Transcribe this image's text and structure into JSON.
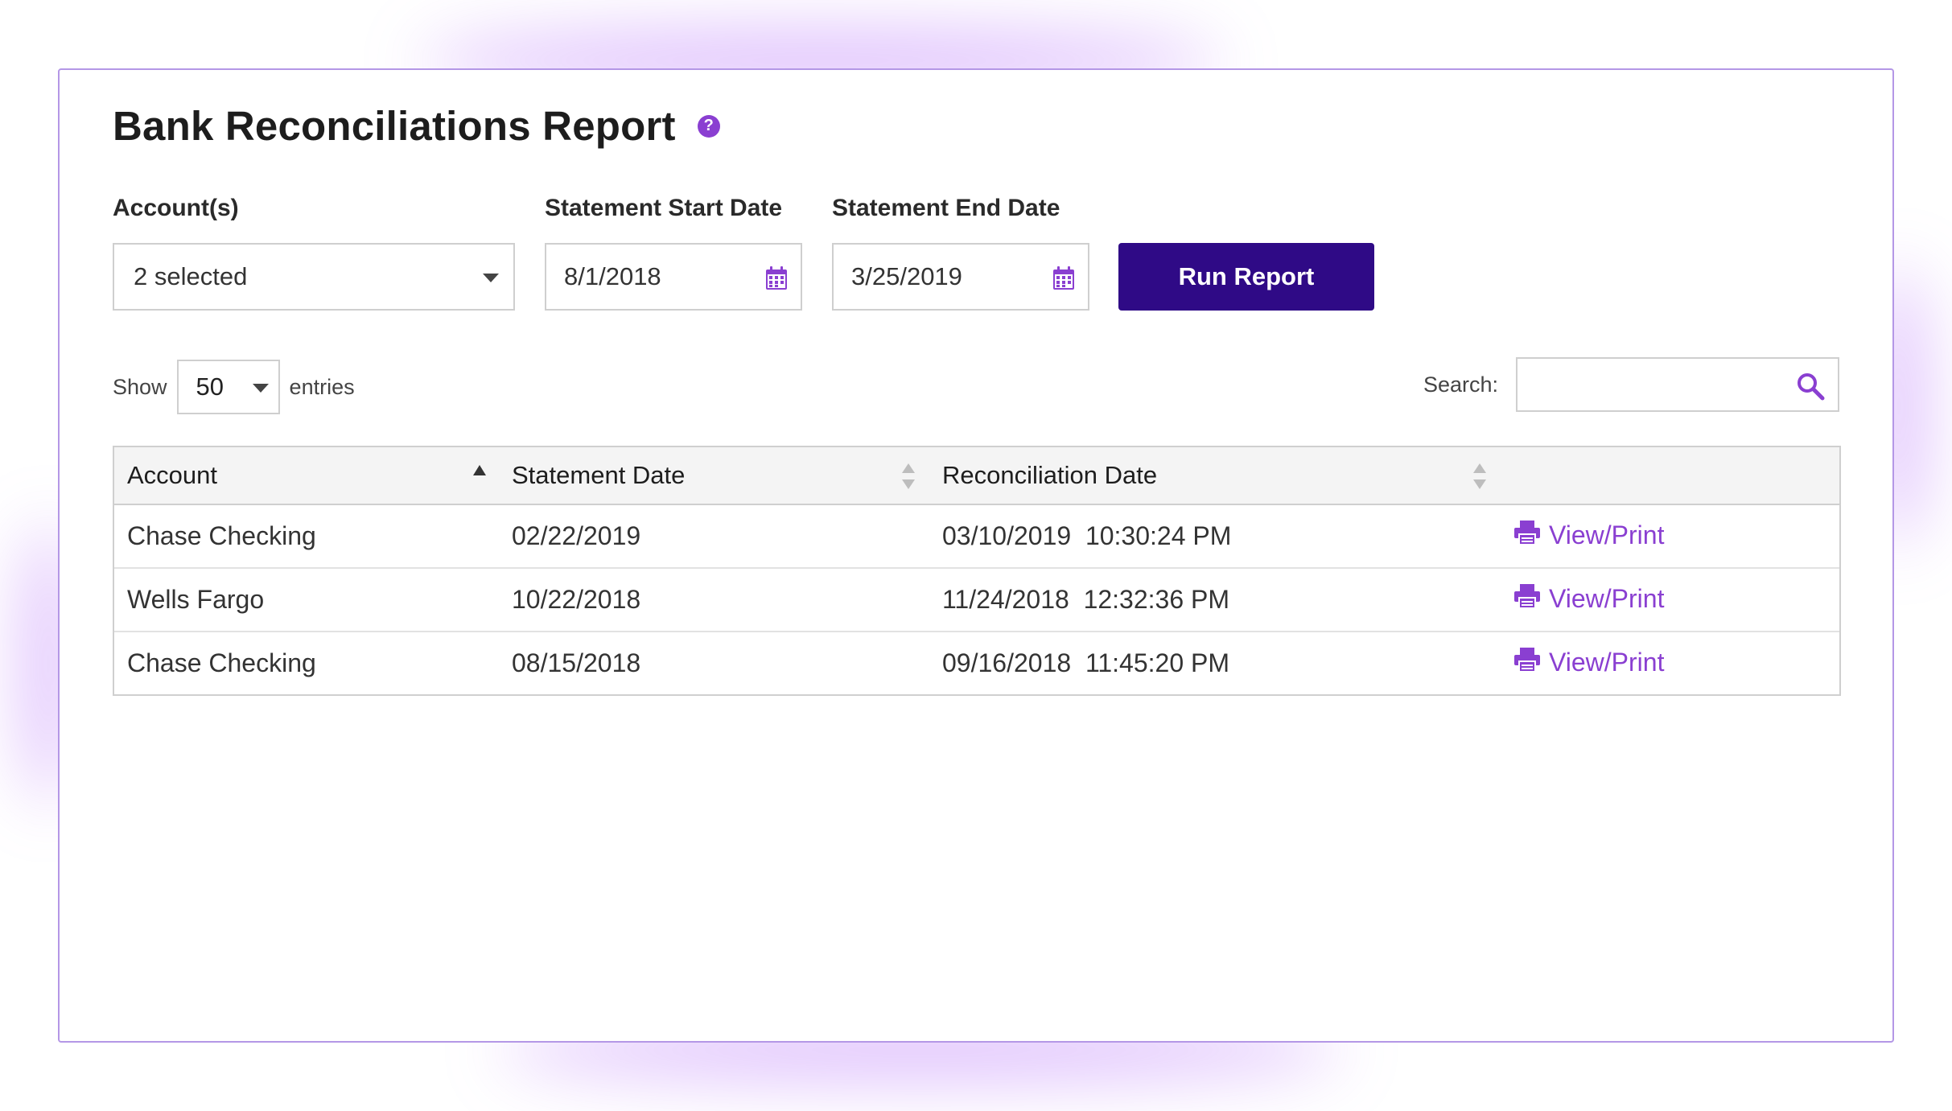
{
  "page": {
    "title": "Bank Reconciliations Report",
    "help_icon": "question-circle",
    "accent_color": "#8a3fd1",
    "button_color": "#2f0a86"
  },
  "filters": {
    "accounts_label": "Account(s)",
    "accounts_value": "2 selected",
    "start_label": "Statement Start Date",
    "start_value": "8/1/2018",
    "end_label": "Statement End Date",
    "end_value": "3/25/2019",
    "calendar_icon": "calendar",
    "run_button": "Run Report"
  },
  "table_controls": {
    "show_label": "Show",
    "page_length": "50",
    "entries_label": "entries",
    "search_label": "Search:",
    "search_value": "",
    "search_icon": "magnifier"
  },
  "table": {
    "columns": [
      "Account",
      "Statement Date",
      "Reconciliation Date",
      ""
    ],
    "sort": {
      "column": "Account",
      "direction": "ascending"
    },
    "rows": [
      {
        "account": "Chase Checking",
        "statement_date": "02/22/2019",
        "reconciliation_date": "03/10/2019  10:30:24 PM",
        "action": "View/Print"
      },
      {
        "account": "Wells Fargo",
        "statement_date": "10/22/2018",
        "reconciliation_date": "11/24/2018  12:32:36 PM",
        "action": "View/Print"
      },
      {
        "account": "Chase Checking",
        "statement_date": "08/15/2018",
        "reconciliation_date": "09/16/2018  11:45:20 PM",
        "action": "View/Print"
      }
    ],
    "action_icon": "printer"
  }
}
